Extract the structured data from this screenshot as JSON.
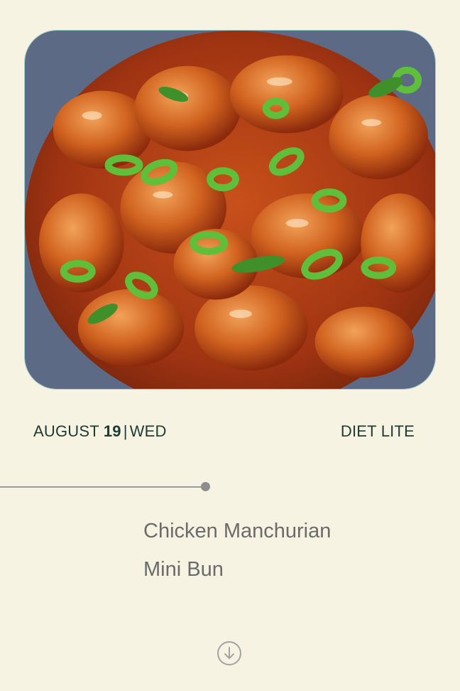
{
  "dish_image": {
    "label": "dish-photo"
  },
  "date": {
    "month": "AUGUST",
    "day": "19",
    "separator": "|",
    "weekday": "WED"
  },
  "plan": {
    "name": "DIET LITE"
  },
  "menu": {
    "items": [
      "Chicken Manchurian",
      "Mini Bun"
    ]
  },
  "icons": {
    "scroll": "arrow-down-circle-icon"
  },
  "colors": {
    "background": "#f6f3e2",
    "heading": "#1d3b34",
    "menu_text": "#6b6b6b"
  }
}
